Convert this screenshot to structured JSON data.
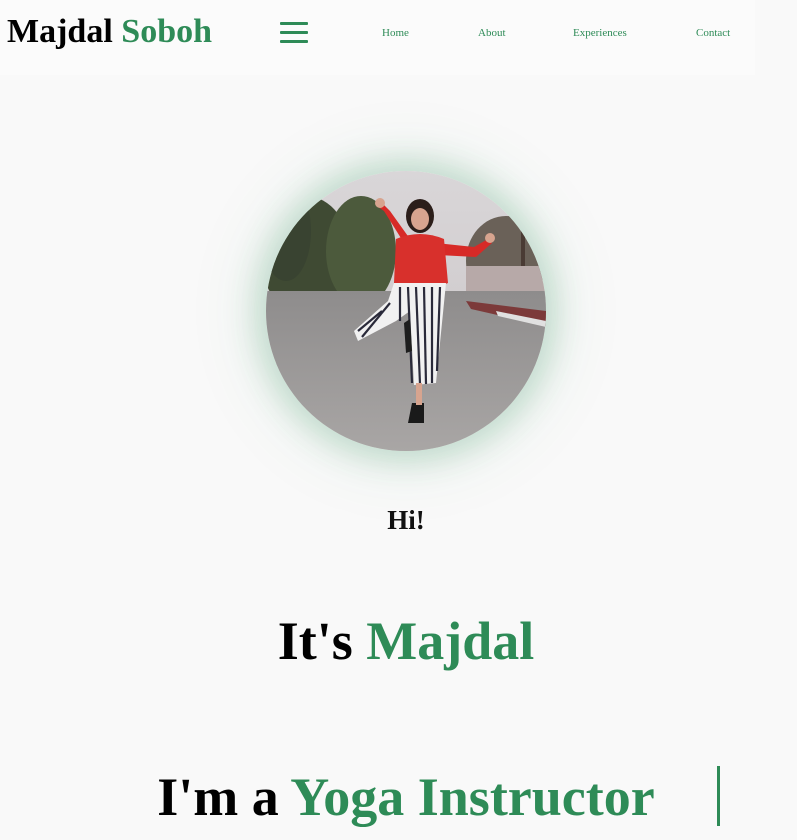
{
  "brand": {
    "first": "Majdal",
    "last": "Soboh"
  },
  "nav": {
    "menu_icon": "hamburger-menu-icon",
    "items": [
      {
        "label": "Home"
      },
      {
        "label": "About"
      },
      {
        "label": "Experiences"
      },
      {
        "label": "Contact"
      }
    ]
  },
  "hero": {
    "greeting": "Hi!",
    "intro_prefix": "It's",
    "intro_name": "Majdal",
    "role_prefix": "I'm a",
    "role_title": "Yoga Instructor"
  },
  "colors": {
    "accent": "#2e8b57",
    "background": "#f9f9f9",
    "text": "#000000"
  }
}
